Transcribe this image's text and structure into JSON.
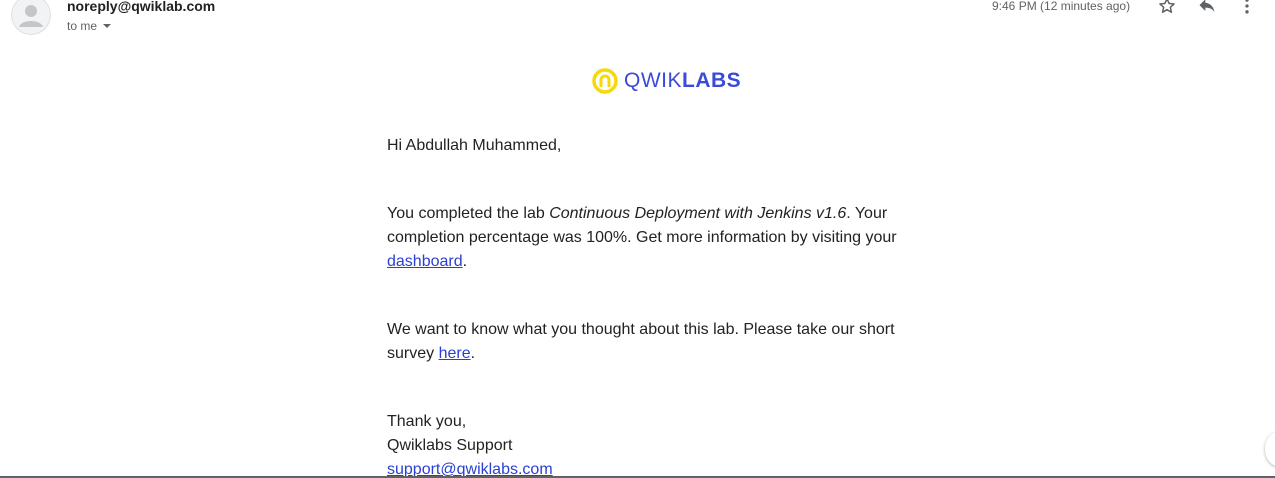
{
  "header": {
    "sender_email": "noreply@qwiklab.com",
    "recipient": "to me",
    "timestamp": "9:46 PM (12 minutes ago)",
    "icons": {
      "avatar": "person-icon",
      "star": "star-icon",
      "reply": "reply-icon",
      "more": "more-vertical-icon"
    }
  },
  "logo": {
    "light": "QWIK",
    "bold": "LABS",
    "colors": {
      "mark": "#f5d90a",
      "text": "#3b4bd8"
    }
  },
  "body": {
    "greeting": "Hi Abdullah Muhammed,",
    "completed_prefix": "You completed the lab ",
    "lab_name": "Continuous Deployment with Jenkins v1.6",
    "completed_suffix": ". Your completion percentage was 100%. Get more information by visiting your ",
    "dashboard_link": "dashboard",
    "period_1": ".",
    "survey_prefix": "We want to know what you thought about this lab. Please take our short survey ",
    "survey_link": "here",
    "period_2": ".",
    "thanks": "Thank you,",
    "signature": "Qwiklabs Support",
    "support_email": "support@qwiklabs.com"
  },
  "colors": {
    "link": "#2a3fd4",
    "text": "#222222",
    "muted": "#5f6368"
  }
}
